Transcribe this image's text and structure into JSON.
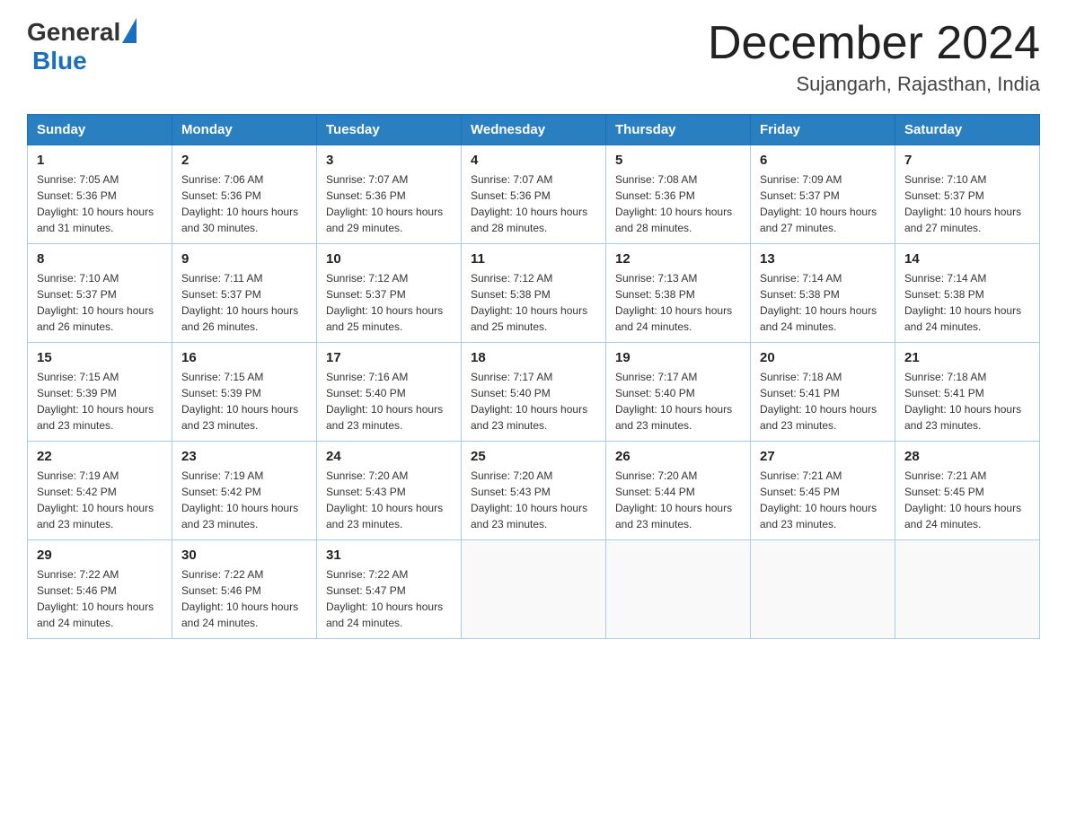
{
  "header": {
    "logo_general": "General",
    "logo_blue": "Blue",
    "month_title": "December 2024",
    "location": "Sujangarh, Rajasthan, India"
  },
  "days_of_week": [
    "Sunday",
    "Monday",
    "Tuesday",
    "Wednesday",
    "Thursday",
    "Friday",
    "Saturday"
  ],
  "weeks": [
    [
      {
        "day": "1",
        "sunrise": "7:05 AM",
        "sunset": "5:36 PM",
        "daylight": "10 hours and 31 minutes."
      },
      {
        "day": "2",
        "sunrise": "7:06 AM",
        "sunset": "5:36 PM",
        "daylight": "10 hours and 30 minutes."
      },
      {
        "day": "3",
        "sunrise": "7:07 AM",
        "sunset": "5:36 PM",
        "daylight": "10 hours and 29 minutes."
      },
      {
        "day": "4",
        "sunrise": "7:07 AM",
        "sunset": "5:36 PM",
        "daylight": "10 hours and 28 minutes."
      },
      {
        "day": "5",
        "sunrise": "7:08 AM",
        "sunset": "5:36 PM",
        "daylight": "10 hours and 28 minutes."
      },
      {
        "day": "6",
        "sunrise": "7:09 AM",
        "sunset": "5:37 PM",
        "daylight": "10 hours and 27 minutes."
      },
      {
        "day": "7",
        "sunrise": "7:10 AM",
        "sunset": "5:37 PM",
        "daylight": "10 hours and 27 minutes."
      }
    ],
    [
      {
        "day": "8",
        "sunrise": "7:10 AM",
        "sunset": "5:37 PM",
        "daylight": "10 hours and 26 minutes."
      },
      {
        "day": "9",
        "sunrise": "7:11 AM",
        "sunset": "5:37 PM",
        "daylight": "10 hours and 26 minutes."
      },
      {
        "day": "10",
        "sunrise": "7:12 AM",
        "sunset": "5:37 PM",
        "daylight": "10 hours and 25 minutes."
      },
      {
        "day": "11",
        "sunrise": "7:12 AM",
        "sunset": "5:38 PM",
        "daylight": "10 hours and 25 minutes."
      },
      {
        "day": "12",
        "sunrise": "7:13 AM",
        "sunset": "5:38 PM",
        "daylight": "10 hours and 24 minutes."
      },
      {
        "day": "13",
        "sunrise": "7:14 AM",
        "sunset": "5:38 PM",
        "daylight": "10 hours and 24 minutes."
      },
      {
        "day": "14",
        "sunrise": "7:14 AM",
        "sunset": "5:38 PM",
        "daylight": "10 hours and 24 minutes."
      }
    ],
    [
      {
        "day": "15",
        "sunrise": "7:15 AM",
        "sunset": "5:39 PM",
        "daylight": "10 hours and 23 minutes."
      },
      {
        "day": "16",
        "sunrise": "7:15 AM",
        "sunset": "5:39 PM",
        "daylight": "10 hours and 23 minutes."
      },
      {
        "day": "17",
        "sunrise": "7:16 AM",
        "sunset": "5:40 PM",
        "daylight": "10 hours and 23 minutes."
      },
      {
        "day": "18",
        "sunrise": "7:17 AM",
        "sunset": "5:40 PM",
        "daylight": "10 hours and 23 minutes."
      },
      {
        "day": "19",
        "sunrise": "7:17 AM",
        "sunset": "5:40 PM",
        "daylight": "10 hours and 23 minutes."
      },
      {
        "day": "20",
        "sunrise": "7:18 AM",
        "sunset": "5:41 PM",
        "daylight": "10 hours and 23 minutes."
      },
      {
        "day": "21",
        "sunrise": "7:18 AM",
        "sunset": "5:41 PM",
        "daylight": "10 hours and 23 minutes."
      }
    ],
    [
      {
        "day": "22",
        "sunrise": "7:19 AM",
        "sunset": "5:42 PM",
        "daylight": "10 hours and 23 minutes."
      },
      {
        "day": "23",
        "sunrise": "7:19 AM",
        "sunset": "5:42 PM",
        "daylight": "10 hours and 23 minutes."
      },
      {
        "day": "24",
        "sunrise": "7:20 AM",
        "sunset": "5:43 PM",
        "daylight": "10 hours and 23 minutes."
      },
      {
        "day": "25",
        "sunrise": "7:20 AM",
        "sunset": "5:43 PM",
        "daylight": "10 hours and 23 minutes."
      },
      {
        "day": "26",
        "sunrise": "7:20 AM",
        "sunset": "5:44 PM",
        "daylight": "10 hours and 23 minutes."
      },
      {
        "day": "27",
        "sunrise": "7:21 AM",
        "sunset": "5:45 PM",
        "daylight": "10 hours and 23 minutes."
      },
      {
        "day": "28",
        "sunrise": "7:21 AM",
        "sunset": "5:45 PM",
        "daylight": "10 hours and 24 minutes."
      }
    ],
    [
      {
        "day": "29",
        "sunrise": "7:22 AM",
        "sunset": "5:46 PM",
        "daylight": "10 hours and 24 minutes."
      },
      {
        "day": "30",
        "sunrise": "7:22 AM",
        "sunset": "5:46 PM",
        "daylight": "10 hours and 24 minutes."
      },
      {
        "day": "31",
        "sunrise": "7:22 AM",
        "sunset": "5:47 PM",
        "daylight": "10 hours and 24 minutes."
      },
      null,
      null,
      null,
      null
    ]
  ],
  "labels": {
    "sunrise": "Sunrise: ",
    "sunset": "Sunset: ",
    "daylight": "Daylight: "
  }
}
